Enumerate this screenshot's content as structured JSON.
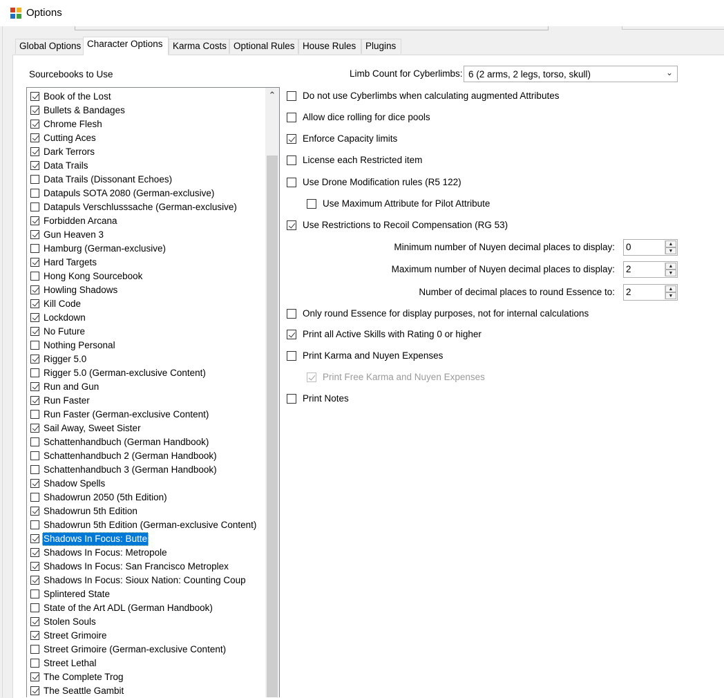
{
  "window": {
    "title": "Options"
  },
  "tabs": [
    "Global Options",
    "Character Options",
    "Karma Costs",
    "Optional Rules",
    "House Rules",
    "Plugins"
  ],
  "active_tab": "Character Options",
  "sourcebooks": {
    "label": "Sourcebooks to Use",
    "items": [
      {
        "label": "Book of the Lost",
        "checked": true
      },
      {
        "label": "Bullets & Bandages",
        "checked": true
      },
      {
        "label": "Chrome Flesh",
        "checked": true
      },
      {
        "label": "Cutting Aces",
        "checked": true
      },
      {
        "label": "Dark Terrors",
        "checked": true
      },
      {
        "label": "Data Trails",
        "checked": true
      },
      {
        "label": "Data Trails (Dissonant Echoes)",
        "checked": false
      },
      {
        "label": "Datapuls SOTA 2080 (German-exclusive)",
        "checked": false
      },
      {
        "label": "Datapuls Verschlusssache (German-exclusive)",
        "checked": false
      },
      {
        "label": "Forbidden Arcana",
        "checked": true
      },
      {
        "label": "Gun Heaven 3",
        "checked": true
      },
      {
        "label": "Hamburg (German-exclusive)",
        "checked": false
      },
      {
        "label": "Hard Targets",
        "checked": true
      },
      {
        "label": "Hong Kong Sourcebook",
        "checked": false
      },
      {
        "label": "Howling Shadows",
        "checked": true
      },
      {
        "label": "Kill Code",
        "checked": true
      },
      {
        "label": "Lockdown",
        "checked": true
      },
      {
        "label": "No Future",
        "checked": true
      },
      {
        "label": "Nothing Personal",
        "checked": false
      },
      {
        "label": "Rigger 5.0",
        "checked": true
      },
      {
        "label": "Rigger 5.0 (German-exclusive Content)",
        "checked": false
      },
      {
        "label": "Run and Gun",
        "checked": true
      },
      {
        "label": "Run Faster",
        "checked": true
      },
      {
        "label": "Run Faster (German-exclusive Content)",
        "checked": false
      },
      {
        "label": "Sail Away, Sweet Sister",
        "checked": true
      },
      {
        "label": "Schattenhandbuch (German Handbook)",
        "checked": false
      },
      {
        "label": "Schattenhandbuch 2 (German Handbook)",
        "checked": false
      },
      {
        "label": "Schattenhandbuch 3 (German Handbook)",
        "checked": false
      },
      {
        "label": "Shadow Spells",
        "checked": true
      },
      {
        "label": "Shadowrun 2050 (5th Edition)",
        "checked": false
      },
      {
        "label": "Shadowrun 5th Edition",
        "checked": true
      },
      {
        "label": "Shadowrun 5th Edition (German-exclusive Content)",
        "checked": false
      },
      {
        "label": "Shadows In Focus: Butte",
        "checked": true,
        "selected": true
      },
      {
        "label": "Shadows In Focus: Metropole",
        "checked": true
      },
      {
        "label": "Shadows In Focus: San Francisco Metroplex",
        "checked": true
      },
      {
        "label": "Shadows In Focus: Sioux Nation: Counting Coup",
        "checked": true
      },
      {
        "label": "Splintered State",
        "checked": false
      },
      {
        "label": "State of the Art ADL (German Handbook)",
        "checked": false
      },
      {
        "label": "Stolen Souls",
        "checked": true
      },
      {
        "label": "Street Grimoire",
        "checked": true
      },
      {
        "label": "Street Grimoire (German-exclusive Content)",
        "checked": false
      },
      {
        "label": "Street Lethal",
        "checked": false
      },
      {
        "label": "The Complete Trog",
        "checked": true
      },
      {
        "label": "The Seattle Gambit",
        "checked": true
      }
    ]
  },
  "limb_count": {
    "label": "Limb Count for Cyberlimbs:",
    "value": "6 (2 arms, 2 legs, torso, skull)"
  },
  "options": [
    {
      "label": "Do not use Cyberlimbs when calculating augmented Attributes",
      "checked": false
    },
    {
      "label": "Allow dice rolling for dice pools",
      "checked": false
    },
    {
      "label": "Enforce Capacity limits",
      "checked": true
    },
    {
      "label": "License each Restricted item",
      "checked": false
    },
    {
      "label": "Use Drone Modification rules (R5 122)",
      "checked": false
    },
    {
      "label": "Use Maximum Attribute for Pilot Attribute",
      "checked": false,
      "indent": true
    },
    {
      "label": "Use Restrictions to Recoil Compensation (RG 53)",
      "checked": true
    }
  ],
  "numeric_options": [
    {
      "label": "Minimum number of Nuyen decimal places to display:",
      "value": "0"
    },
    {
      "label": "Maximum number of Nuyen decimal places to display:",
      "value": "2"
    },
    {
      "label": "Number of decimal places to round Essence to:",
      "value": "2"
    }
  ],
  "options_bottom": [
    {
      "label": "Only round Essence for display purposes, not for internal calculations",
      "checked": false
    },
    {
      "label": "Print all Active Skills with Rating 0 or higher",
      "checked": true
    },
    {
      "label": "Print Karma and Nuyen Expenses",
      "checked": false
    },
    {
      "label": "Print Free Karma and Nuyen Expenses",
      "checked": true,
      "disabled": true,
      "indent": true
    },
    {
      "label": "Print Notes",
      "checked": false
    }
  ]
}
